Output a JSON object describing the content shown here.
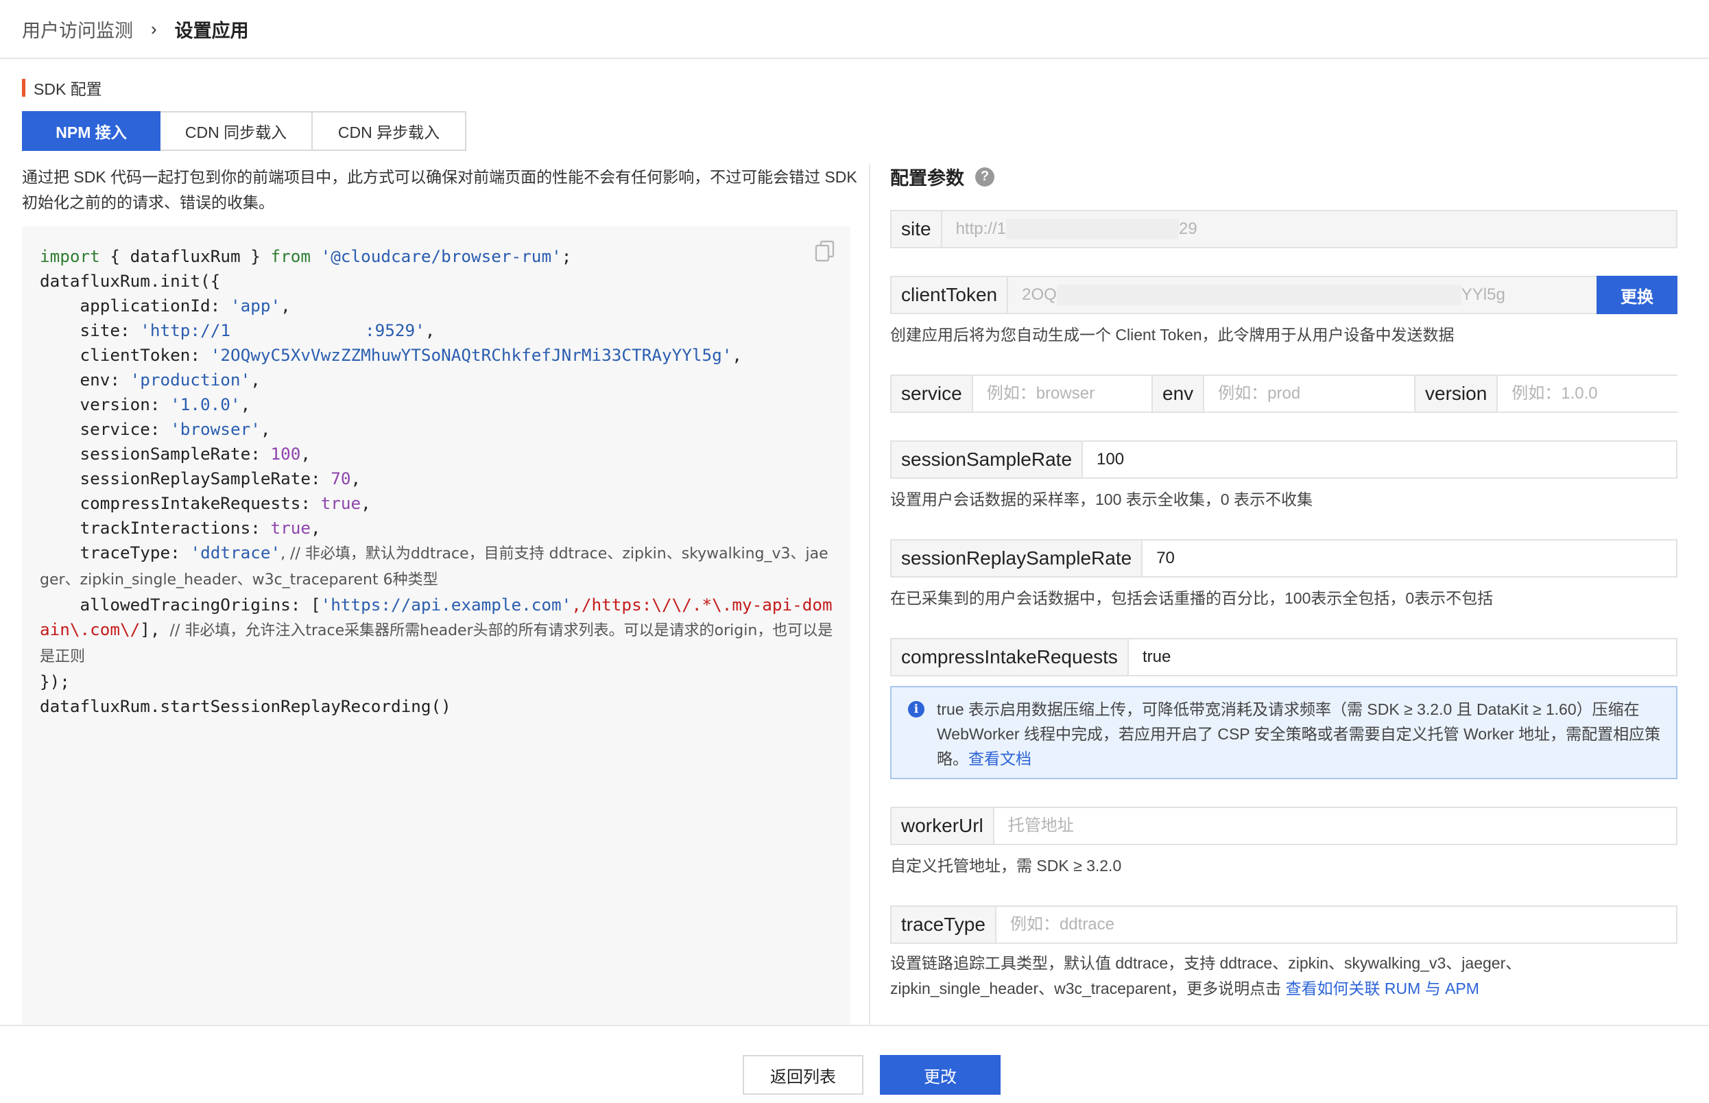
{
  "breadcrumb": {
    "parent": "用户访问监测",
    "separator": "›",
    "current": "设置应用"
  },
  "section_title": "SDK 配置",
  "tabs": [
    {
      "label": "NPM 接入",
      "active": true
    },
    {
      "label": "CDN 同步载入",
      "active": false
    },
    {
      "label": "CDN 异步载入",
      "active": false
    }
  ],
  "description": "通过把 SDK 代码一起打包到你的前端项目中，此方式可以确保对前端页面的性能不会有任何影响，不过可能会错过 SDK 初始化之前的的请求、错误的收集。",
  "code": {
    "l1_kw1": "import",
    "l1_mid": " { datafluxRum } ",
    "l1_kw2": "from",
    "l1_str": "'@cloudcare/browser-rum'",
    "l1_end": ";",
    "l2": "datafluxRum.init({",
    "app_key": "    applicationId: ",
    "app_val": "'app'",
    "site_key": "    site: ",
    "site_val_a": "'http://1",
    "site_val_b": ":9529'",
    "token_key": "    clientToken: ",
    "token_val": "'2OQwyC5XvVwzZZMhuwYTSoNAQtRChkfefJNrMi33CTRAyYYl5g'",
    "env_key": "    env: ",
    "env_val": "'production'",
    "ver_key": "    version: ",
    "ver_val": "'1.0.0'",
    "svc_key": "    service: ",
    "svc_val": "'browser'",
    "ssr_key": "    sessionSampleRate: ",
    "ssr_val": "100",
    "srsr_key": "    sessionReplaySampleRate: ",
    "srsr_val": "70",
    "cir_key": "    compressIntakeRequests: ",
    "cir_val": "true",
    "ti_key": "    trackInteractions: ",
    "ti_val": "true",
    "tt_key": "    traceType: ",
    "tt_val": "'ddtrace'",
    "tt_comment": ", // 非必填，默认为ddtrace，目前支持 ddtrace、zipkin、skywalking_v3、jaeger、zipkin_single_header、w3c_traceparent 6种类型",
    "ato_key": "    allowedTracingOrigins: [",
    "ato_str": "'https://api.example.com'",
    "ato_rx": ",/https:\\/\\/.*\\.my-api-domain\\.com\\/",
    "ato_end": "],",
    "ato_comment": "  // 非必填，允许注入trace采集器所需header头部的所有请求列表。可以是请求的origin，也可以是是正则",
    "close": "});",
    "last": "datafluxRum.startSessionReplayRecording()"
  },
  "config": {
    "title": "配置参数",
    "help_icon": "question-circle-icon",
    "site": {
      "label": "site",
      "value_prefix": "http://1",
      "value_suffix": "29"
    },
    "client_token": {
      "label": "clientToken",
      "value_prefix": "2OQ",
      "value_suffix": "YYl5g",
      "button": "更换",
      "hint": "创建应用后将为您自动生成一个 Client Token，此令牌用于从用户设备中发送数据"
    },
    "service": {
      "label": "service",
      "placeholder": "例如：browser"
    },
    "env": {
      "label": "env",
      "placeholder": "例如：prod"
    },
    "version": {
      "label": "version",
      "placeholder": "例如：1.0.0"
    },
    "session_sample_rate": {
      "label": "sessionSampleRate",
      "value": "100",
      "hint": "设置用户会话数据的采样率，100 表示全收集，0 表示不收集"
    },
    "session_replay_sample_rate": {
      "label": "sessionReplaySampleRate",
      "value": "70",
      "hint": "在已采集到的用户会话数据中，包括会话重播的百分比，100表示全包括，0表示不包括"
    },
    "compress_intake_requests": {
      "label": "compressIntakeRequests",
      "value": "true",
      "info_text": "true 表示启用数据压缩上传，可降低带宽消耗及请求频率（需 SDK ≥ 3.2.0 且 DataKit ≥ 1.60）压缩在 WebWorker 线程中完成，若应用开启了 CSP 安全策略或者需要自定义托管 Worker 地址，需配置相应策略。",
      "info_link": "查看文档"
    },
    "worker_url": {
      "label": "workerUrl",
      "placeholder": "托管地址",
      "hint": "自定义托管地址，需 SDK ≥ 3.2.0"
    },
    "trace_type": {
      "label": "traceType",
      "placeholder": "例如：ddtrace",
      "hint_line1": "设置链路追踪工具类型，默认值 ddtrace，支持 ddtrace、zipkin、skywalking_v3、jaeger、",
      "hint_line2": "zipkin_single_header、w3c_traceparent，更多说明点击 ",
      "hint_link": "查看如何关联 RUM 与 APM"
    }
  },
  "footer": {
    "back_label": "返回列表",
    "submit_label": "更改"
  },
  "colors": {
    "primary": "#2d64d8",
    "section_accent": "#e85a2a",
    "code_keyword": "#2e7d32",
    "code_string": "#2a5db0",
    "code_number": "#8e44ad",
    "code_regex": "#c51b1b"
  }
}
